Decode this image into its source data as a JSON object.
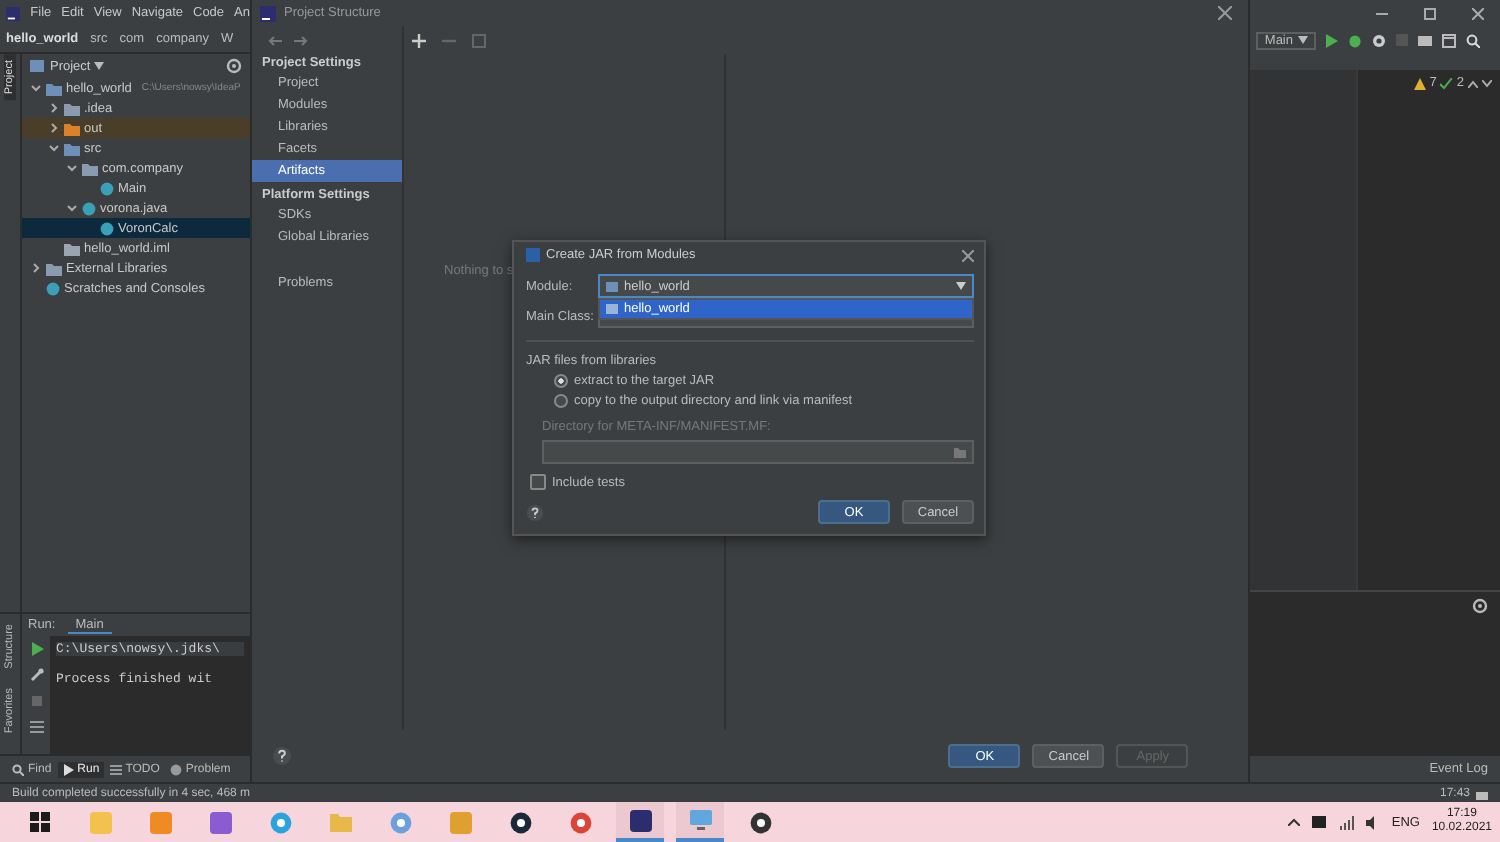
{
  "ide": {
    "menu": [
      "File",
      "Edit",
      "View",
      "Navigate",
      "Code",
      "An"
    ],
    "breadcrumbs": [
      "hello_world",
      "src",
      "com",
      "company",
      "W"
    ],
    "side_tabs": [
      {
        "label": "Project",
        "selected": true
      }
    ],
    "bottom_side_tabs": [
      "Structure",
      "Favorites"
    ],
    "project_view": "Project",
    "tree": [
      {
        "label": "hello_world",
        "hint": "C:\\Users\\nowsy\\IdeaP",
        "kind": "module",
        "expanded": true,
        "selected": false,
        "children": [
          {
            "label": ".idea",
            "kind": "folder",
            "expanded": false,
            "selected": false
          },
          {
            "label": "out",
            "kind": "excluded",
            "expanded": false,
            "selected": false
          },
          {
            "label": "src",
            "kind": "source",
            "expanded": true,
            "selected": false,
            "children": [
              {
                "label": "com.company",
                "kind": "package",
                "expanded": true,
                "selected": false,
                "children": [
                  {
                    "label": "Main",
                    "kind": "class",
                    "selected": false
                  }
                ]
              },
              {
                "label": "vorona.java",
                "kind": "class",
                "expanded": true,
                "selected": false,
                "children": [
                  {
                    "label": "VoronCalc",
                    "kind": "class",
                    "selected": true
                  }
                ]
              }
            ]
          },
          {
            "label": "hello_world.iml",
            "kind": "iml",
            "selected": false
          }
        ]
      },
      {
        "label": "External Libraries",
        "kind": "library",
        "expanded": false,
        "selected": false
      },
      {
        "label": "Scratches and Consoles",
        "kind": "scratch",
        "selected": false
      }
    ],
    "run_panel": {
      "title": "Run:",
      "tab": "Main",
      "lines": [
        "C:\\Users\\nowsy\\.jdks\\",
        "Process finished wit"
      ]
    },
    "tool_tabs": [
      {
        "label": "Find",
        "kind": "search",
        "selected": false
      },
      {
        "label": "Run",
        "kind": "run",
        "selected": true
      },
      {
        "label": "TODO",
        "kind": "list",
        "selected": false
      },
      {
        "label": "Problem",
        "kind": "problem",
        "selected": false
      }
    ],
    "status": "Build completed successfully in 4 sec, 468 m",
    "run_config": "Main",
    "warnings": "7",
    "checks": "2",
    "event_log": "Event Log",
    "clock": "17:43"
  },
  "project_structure": {
    "title": "Project Structure",
    "sections": [
      {
        "heading": "Project Settings",
        "items": [
          {
            "label": "Project",
            "selected": false
          },
          {
            "label": "Modules",
            "selected": false
          },
          {
            "label": "Libraries",
            "selected": false
          },
          {
            "label": "Facets",
            "selected": false
          },
          {
            "label": "Artifacts",
            "selected": true
          }
        ]
      },
      {
        "heading": "Platform Settings",
        "items": [
          {
            "label": "SDKs",
            "selected": false
          },
          {
            "label": "Global Libraries",
            "selected": false
          }
        ]
      }
    ],
    "extra_items": [
      {
        "label": "Problems",
        "selected": false
      }
    ],
    "empty_text": "Nothing to s",
    "buttons": [
      {
        "label": "OK",
        "kind": "primary"
      },
      {
        "label": "Cancel",
        "kind": "normal"
      },
      {
        "label": "Apply",
        "kind": "disabled"
      }
    ]
  },
  "dialog": {
    "title": "Create JAR from Modules",
    "module_label": "Module:",
    "module_value": "hello_world",
    "options": [
      {
        "label": "hello_world",
        "selected": true
      }
    ],
    "main_class_label": "Main Class:",
    "libraries_heading": "JAR files from libraries",
    "radios": [
      {
        "label": "extract to the target JAR",
        "selected": true
      },
      {
        "label": "copy to the output directory and link via manifest",
        "selected": false
      }
    ],
    "manifest_label": "Directory for META-INF/MANIFEST.MF:",
    "include_tests": {
      "label": "Include tests",
      "checked": false
    },
    "buttons": [
      {
        "label": "OK",
        "kind": "primary"
      },
      {
        "label": "Cancel",
        "kind": "normal"
      }
    ]
  },
  "taskbar": {
    "apps": [
      {
        "kind": "start",
        "active": false
      },
      {
        "kind": "pen",
        "active": false
      },
      {
        "kind": "sublime",
        "active": false
      },
      {
        "kind": "vs",
        "active": false
      },
      {
        "kind": "telegram",
        "active": false
      },
      {
        "kind": "folder",
        "active": false
      },
      {
        "kind": "python",
        "active": false
      },
      {
        "kind": "xd",
        "active": false
      },
      {
        "kind": "steam",
        "active": false
      },
      {
        "kind": "chrome",
        "active": false
      },
      {
        "kind": "intellij",
        "active": true
      },
      {
        "kind": "monitor",
        "active": true
      },
      {
        "kind": "disc",
        "active": false
      }
    ],
    "language": "ENG",
    "time": "17:19",
    "date": "10.02.2021"
  }
}
